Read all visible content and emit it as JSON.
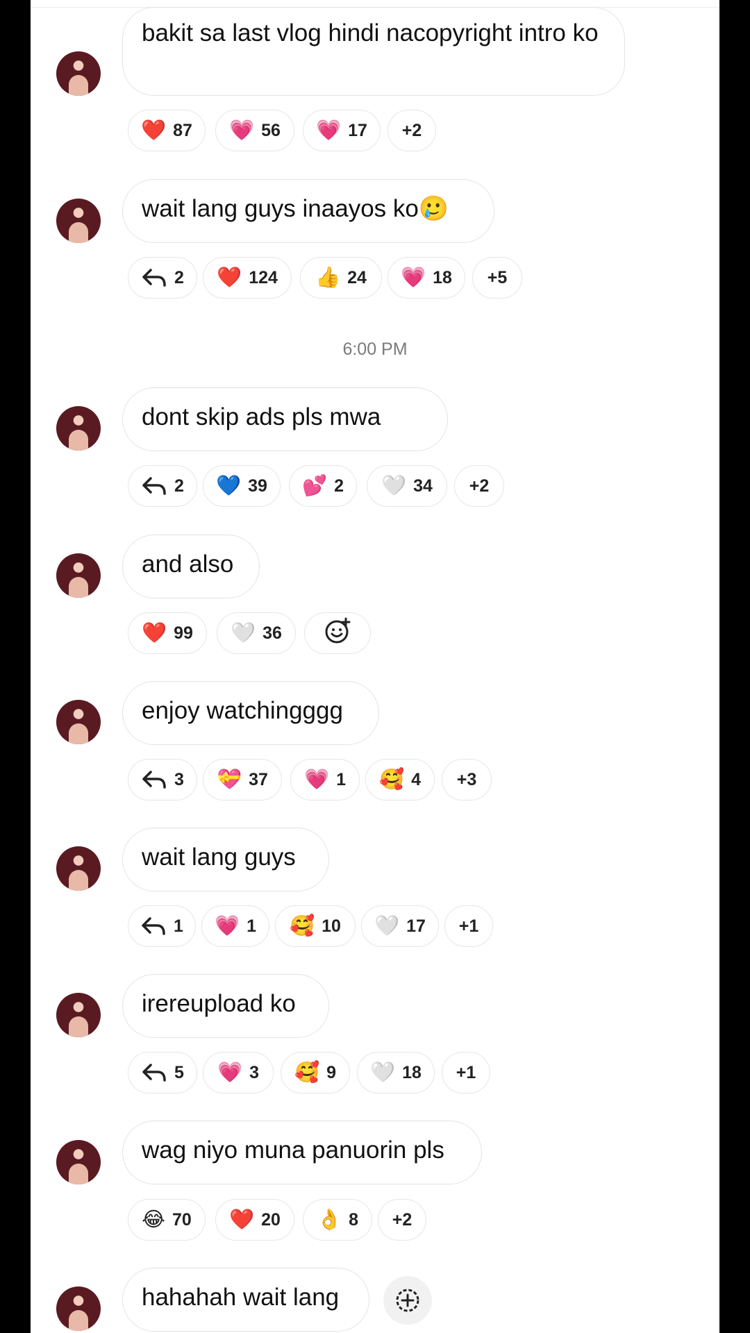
{
  "timestamp": "6:00 PM",
  "messages": [
    {
      "text": "bakit sa last vlog hindi nacopyright intro ko",
      "reactions": [
        {
          "type": "emoji",
          "icon": "red-heart-icon",
          "glyph": "❤️",
          "count": "87"
        },
        {
          "type": "emoji",
          "icon": "growing-heart-icon",
          "glyph": "💗",
          "count": "56"
        },
        {
          "type": "emoji",
          "icon": "pink-heart-icon",
          "glyph": "💗",
          "count": "17"
        },
        {
          "type": "more",
          "count": "+2"
        }
      ]
    },
    {
      "text": "wait lang guys inaayos ko🥲",
      "reactions": [
        {
          "type": "reply",
          "count": "2"
        },
        {
          "type": "emoji",
          "icon": "red-heart-icon",
          "glyph": "❤️",
          "count": "124"
        },
        {
          "type": "emoji",
          "icon": "thumbs-up-icon",
          "glyph": "👍",
          "count": "24"
        },
        {
          "type": "emoji",
          "icon": "pink-heart-icon",
          "glyph": "💗",
          "count": "18"
        },
        {
          "type": "more",
          "count": "+5"
        }
      ]
    },
    {
      "text": "dont skip ads pls mwa",
      "reactions": [
        {
          "type": "reply",
          "count": "2"
        },
        {
          "type": "emoji",
          "icon": "blue-heart-icon",
          "glyph": "💙",
          "count": "39"
        },
        {
          "type": "emoji",
          "icon": "two-hearts-icon",
          "glyph": "💕",
          "count": "2"
        },
        {
          "type": "emoji",
          "icon": "white-heart-icon",
          "glyph": "🤍",
          "count": "34"
        },
        {
          "type": "more",
          "count": "+2"
        }
      ]
    },
    {
      "text": "and also",
      "reactions": [
        {
          "type": "emoji",
          "icon": "red-heart-icon",
          "glyph": "❤️",
          "count": "99"
        },
        {
          "type": "emoji",
          "icon": "white-heart-icon",
          "glyph": "🤍",
          "count": "36"
        },
        {
          "type": "add"
        }
      ]
    },
    {
      "text": "enjoy watchingggg",
      "reactions": [
        {
          "type": "reply",
          "count": "3"
        },
        {
          "type": "emoji",
          "icon": "heart-with-ribbon-icon",
          "glyph": "💝",
          "count": "37"
        },
        {
          "type": "emoji",
          "icon": "pink-heart-icon",
          "glyph": "💗",
          "count": "1"
        },
        {
          "type": "emoji",
          "icon": "smiling-face-with-hearts-icon",
          "glyph": "🥰",
          "count": "4"
        },
        {
          "type": "more",
          "count": "+3"
        }
      ]
    },
    {
      "text": "wait lang guys",
      "reactions": [
        {
          "type": "reply",
          "count": "1"
        },
        {
          "type": "emoji",
          "icon": "pink-heart-icon",
          "glyph": "💗",
          "count": "1"
        },
        {
          "type": "emoji",
          "icon": "smiling-face-with-hearts-icon",
          "glyph": "🥰",
          "count": "10"
        },
        {
          "type": "emoji",
          "icon": "white-heart-icon",
          "glyph": "🤍",
          "count": "17"
        },
        {
          "type": "more",
          "count": "+1"
        }
      ]
    },
    {
      "text": "irereupload ko",
      "reactions": [
        {
          "type": "reply",
          "count": "5"
        },
        {
          "type": "emoji",
          "icon": "pink-heart-icon",
          "glyph": "💗",
          "count": "3"
        },
        {
          "type": "emoji",
          "icon": "smiling-face-with-hearts-icon",
          "glyph": "🥰",
          "count": "9"
        },
        {
          "type": "emoji",
          "icon": "white-heart-icon",
          "glyph": "🤍",
          "count": "18"
        },
        {
          "type": "more",
          "count": "+1"
        }
      ]
    },
    {
      "text": "wag niyo muna panuorin pls",
      "reactions": [
        {
          "type": "emoji",
          "icon": "tears-of-joy-icon",
          "glyph": "😂",
          "count": "70"
        },
        {
          "type": "emoji",
          "icon": "red-heart-icon",
          "glyph": "❤️",
          "count": "20"
        },
        {
          "type": "emoji",
          "icon": "ok-hand-icon",
          "glyph": "👌",
          "count": "8"
        },
        {
          "type": "more",
          "count": "+2"
        }
      ]
    },
    {
      "text": "hahahah wait lang",
      "reactions": []
    }
  ]
}
